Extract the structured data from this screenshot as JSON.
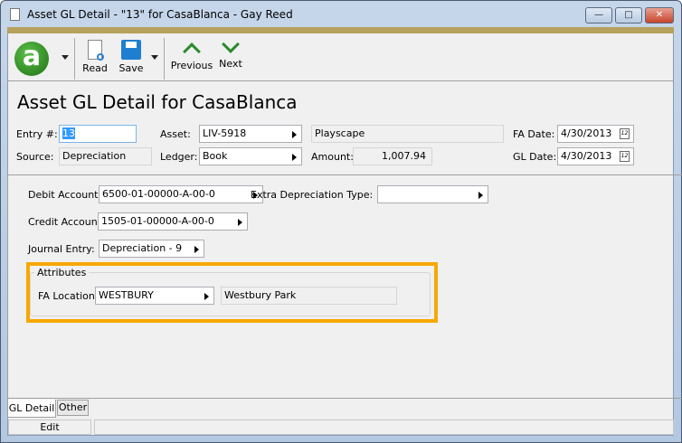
{
  "window": {
    "title": "Asset GL Detail - \"13\" for CasaBlanca - Gay Reed",
    "minimize": "—",
    "maximize": "□",
    "close": "✕"
  },
  "toolbar": {
    "read": "Read",
    "save": "Save",
    "previous": "Previous",
    "next": "Next",
    "logo_letter": "a"
  },
  "page_title": "Asset GL Detail for CasaBlanca",
  "header": {
    "entry_label": "Entry #:",
    "entry_value": "13",
    "asset_label": "Asset:",
    "asset_value": "LIV-5918",
    "asset_desc": "Playscape",
    "fa_date_label": "FA Date:",
    "fa_date": "4/30/2013",
    "source_label": "Source:",
    "source_value": "Depreciation",
    "ledger_label": "Ledger:",
    "ledger_value": "Book",
    "amount_label": "Amount:",
    "amount_value": "1,007.94",
    "gl_date_label": "GL Date:",
    "gl_date": "4/30/2013",
    "cal_glyph": "12"
  },
  "detail": {
    "debit_label": "Debit Account:",
    "debit_value": "6500-01-00000-A-00-0",
    "extra_label": "Extra Depreciation Type:",
    "extra_value": "",
    "credit_label": "Credit Account:",
    "credit_value": "1505-01-00000-A-00-0",
    "journal_label": "Journal Entry:",
    "journal_value": "Depreciation - 9",
    "attributes_legend": "Attributes",
    "fa_location_label": "FA Location:",
    "fa_location_value": "WESTBURY",
    "fa_location_desc": "Westbury Park"
  },
  "tabs": [
    {
      "label": "GL Detail",
      "active": true
    },
    {
      "label": "Other",
      "active": false
    }
  ],
  "status": {
    "mode": "Edit",
    "message": ""
  },
  "colors": {
    "highlight": "#f7a800",
    "accent_bar": "#b6a25c",
    "logo": "#2a8a1c",
    "nav_arrows": "#2a8a2a",
    "save_icon": "#1e7fd0"
  }
}
